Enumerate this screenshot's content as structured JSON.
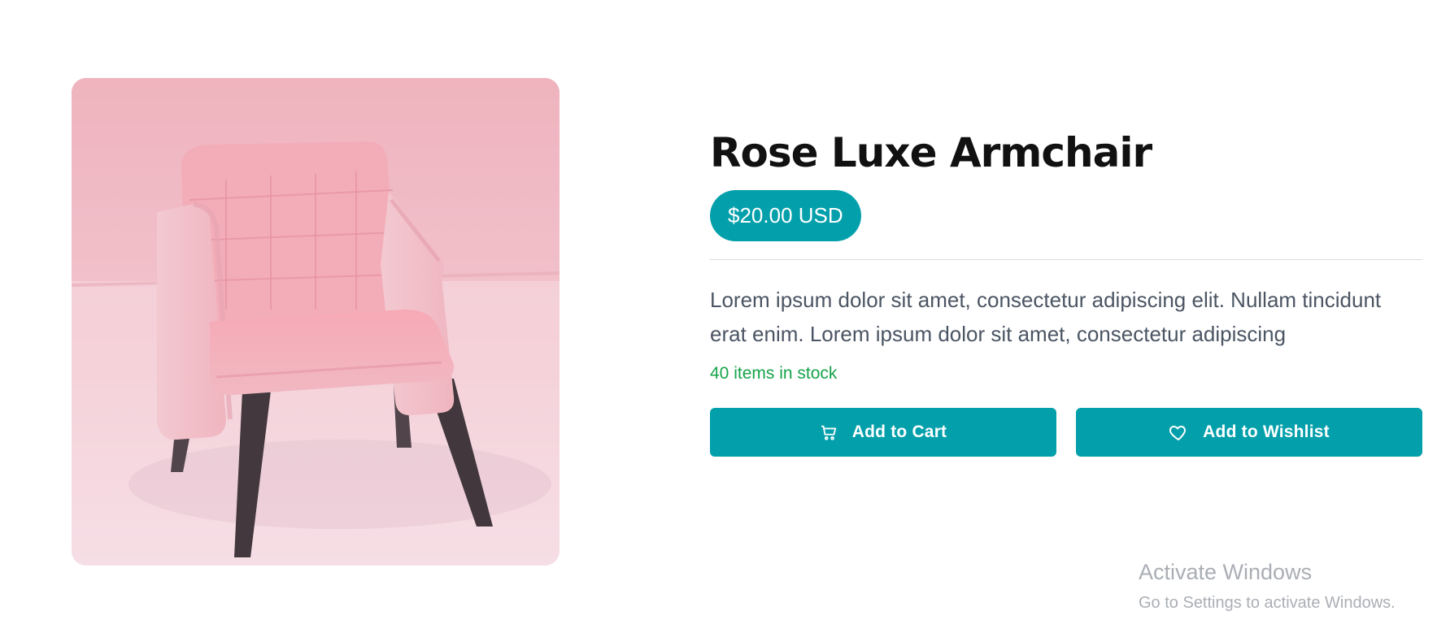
{
  "product": {
    "image_alt": "pink-armchair-photo",
    "title": "Rose Luxe Armchair",
    "price": "$20.00 USD",
    "description": "Lorem ipsum dolor sit amet, consectetur adipiscing elit. Nullam tincidunt erat enim. Lorem ipsum dolor sit amet, consectetur adipiscing",
    "stock": "40 items in stock"
  },
  "actions": {
    "add_to_cart": {
      "label": "Add to Cart",
      "icon": "cart-icon"
    },
    "add_to_wishlist": {
      "label": "Add to Wishlist",
      "icon": "heart-icon"
    }
  },
  "overlay": {
    "title": "Activate Windows",
    "subtitle": "Go to Settings to activate Windows."
  },
  "colors": {
    "accent": "#03a0ab",
    "stock_green": "#16a34a",
    "text_dark": "#111111",
    "text_muted": "#4b5563"
  }
}
